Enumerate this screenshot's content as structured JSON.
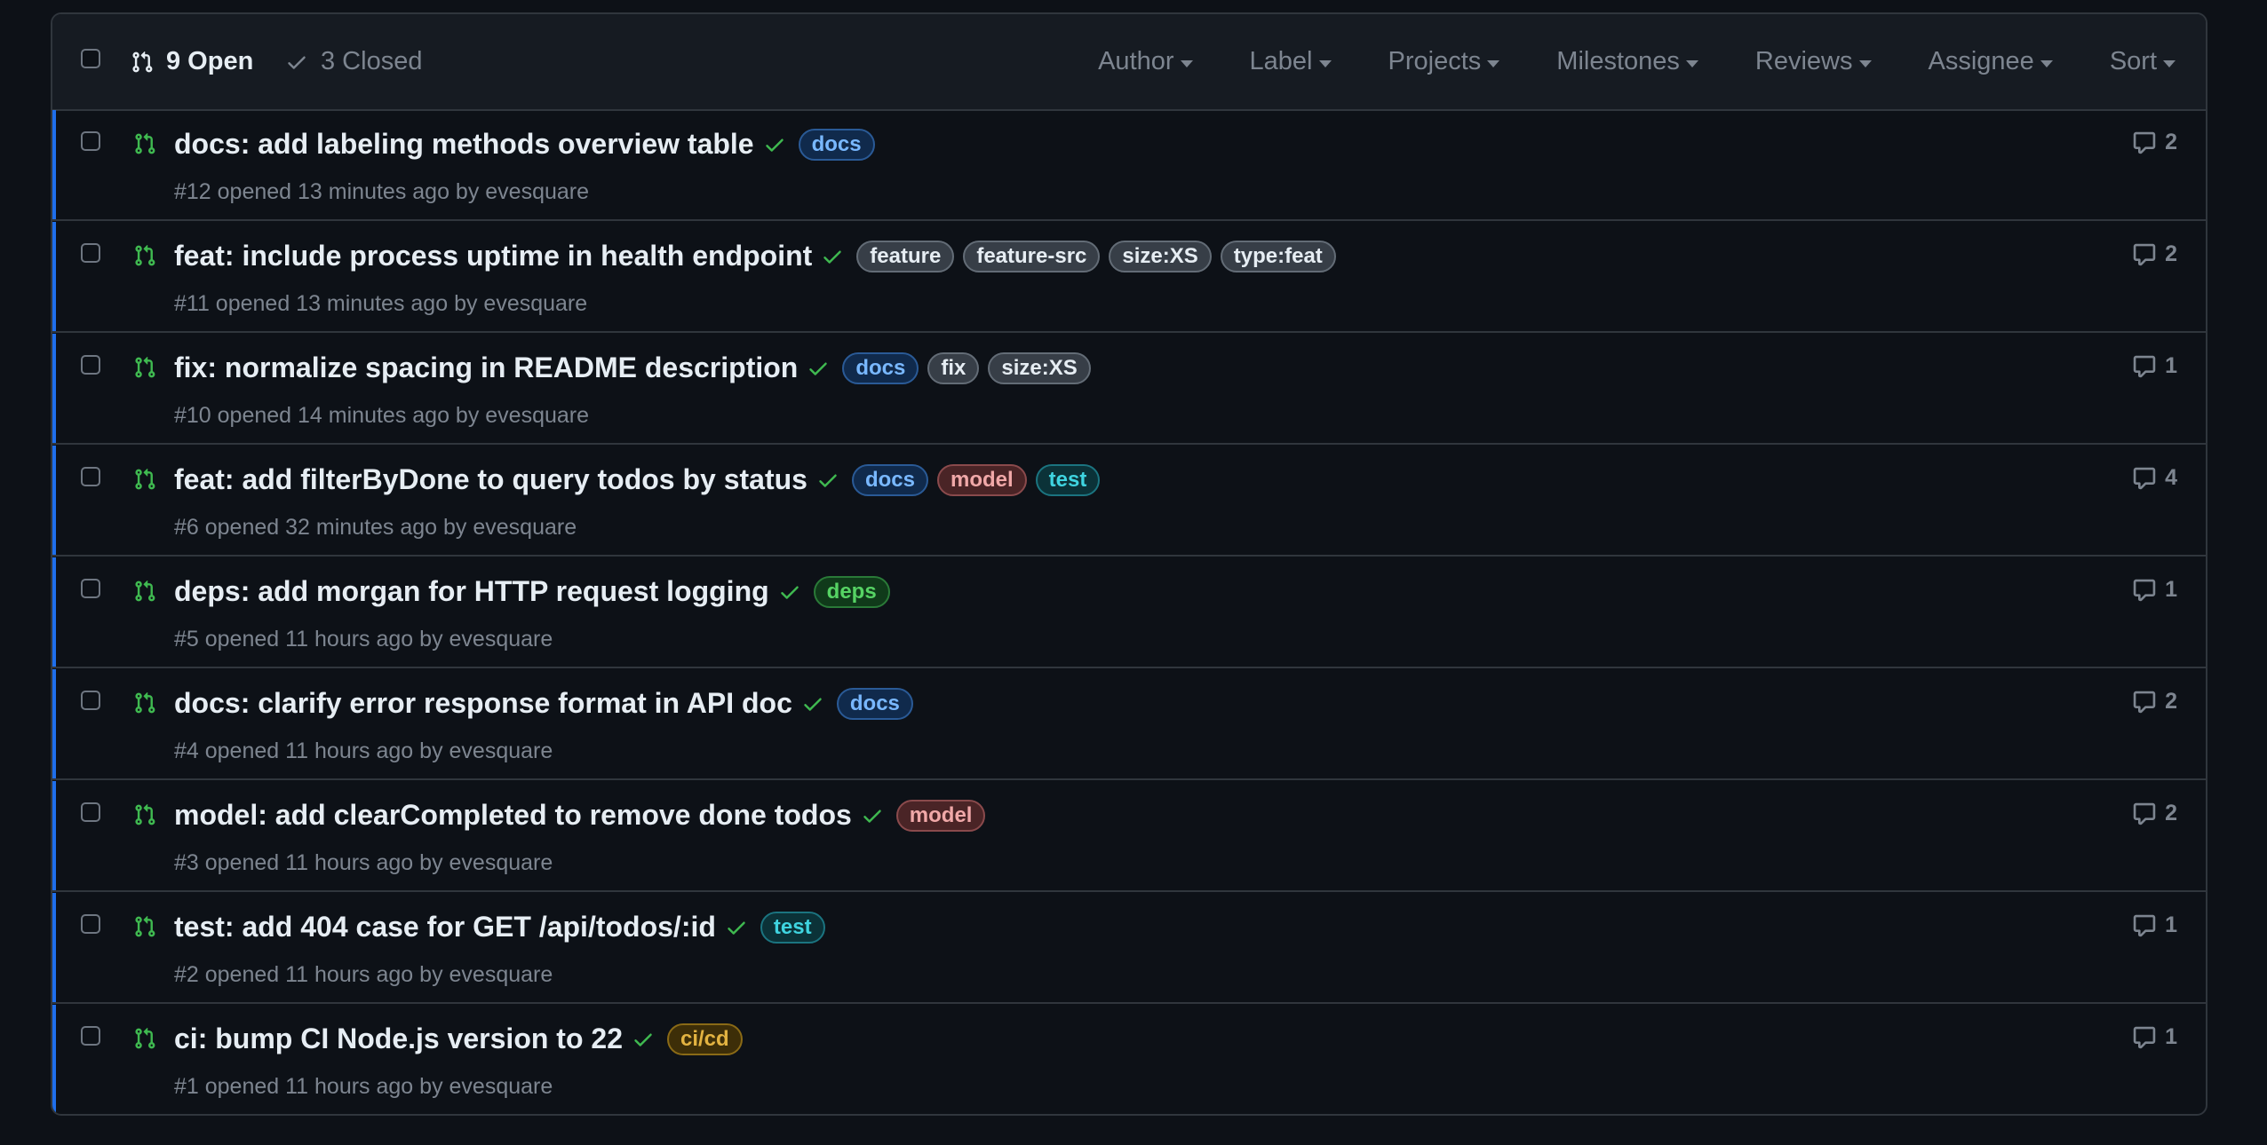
{
  "header": {
    "open_label": "9 Open",
    "closed_label": "3 Closed",
    "filters": [
      "Author",
      "Label",
      "Projects",
      "Milestones",
      "Reviews",
      "Assignee",
      "Sort"
    ]
  },
  "colors": {
    "background": "#0d1117",
    "accent": "#1f6feb",
    "pr_open_green": "#3fb950"
  },
  "labels": {
    "docs": {
      "text": "docs",
      "fg": "#79b8ff",
      "bg": "#102a4c",
      "border": "#2a5a96"
    },
    "feature": {
      "text": "feature",
      "fg": "#e6edf3",
      "bg": "#373e47",
      "border": "#636c76"
    },
    "feature-src": {
      "text": "feature-src",
      "fg": "#e6edf3",
      "bg": "#373e47",
      "border": "#636c76"
    },
    "size:XS": {
      "text": "size:XS",
      "fg": "#e6edf3",
      "bg": "#373e47",
      "border": "#636c76"
    },
    "type:feat": {
      "text": "type:feat",
      "fg": "#e6edf3",
      "bg": "#373e47",
      "border": "#636c76"
    },
    "fix": {
      "text": "fix",
      "fg": "#e6edf3",
      "bg": "#373e47",
      "border": "#636c76"
    },
    "model": {
      "text": "model",
      "fg": "#f0a8a8",
      "bg": "#4a2426",
      "border": "#8a4a4c"
    },
    "test": {
      "text": "test",
      "fg": "#3fd4e0",
      "bg": "#0b3238",
      "border": "#1b7480"
    },
    "deps": {
      "text": "deps",
      "fg": "#56d364",
      "bg": "#103a1a",
      "border": "#2a7a38"
    },
    "ci/cd": {
      "text": "ci/cd",
      "fg": "#e3b341",
      "bg": "#3d2e08",
      "border": "#8a6a16"
    }
  },
  "pulls": [
    {
      "title": "docs: add labeling methods overview table",
      "labels": [
        "docs"
      ],
      "meta": "#12 opened 13 minutes ago by evesquare",
      "comments": "2"
    },
    {
      "title": "feat: include process uptime in health endpoint",
      "labels": [
        "feature",
        "feature-src",
        "size:XS",
        "type:feat"
      ],
      "meta": "#11 opened 13 minutes ago by evesquare",
      "comments": "2"
    },
    {
      "title": "fix: normalize spacing in README description",
      "labels": [
        "docs",
        "fix",
        "size:XS"
      ],
      "meta": "#10 opened 14 minutes ago by evesquare",
      "comments": "1"
    },
    {
      "title": "feat: add filterByDone to query todos by status",
      "labels": [
        "docs",
        "model",
        "test"
      ],
      "meta": "#6 opened 32 minutes ago by evesquare",
      "comments": "4"
    },
    {
      "title": "deps: add morgan for HTTP request logging",
      "labels": [
        "deps"
      ],
      "meta": "#5 opened 11 hours ago by evesquare",
      "comments": "1"
    },
    {
      "title": "docs: clarify error response format in API doc",
      "labels": [
        "docs"
      ],
      "meta": "#4 opened 11 hours ago by evesquare",
      "comments": "2"
    },
    {
      "title": "model: add clearCompleted to remove done todos",
      "labels": [
        "model"
      ],
      "meta": "#3 opened 11 hours ago by evesquare",
      "comments": "2"
    },
    {
      "title": "test: add 404 case for GET /api/todos/:id",
      "labels": [
        "test"
      ],
      "meta": "#2 opened 11 hours ago by evesquare",
      "comments": "1"
    },
    {
      "title": "ci: bump CI Node.js version to 22",
      "labels": [
        "ci/cd"
      ],
      "meta": "#1 opened 11 hours ago by evesquare",
      "comments": "1"
    }
  ]
}
